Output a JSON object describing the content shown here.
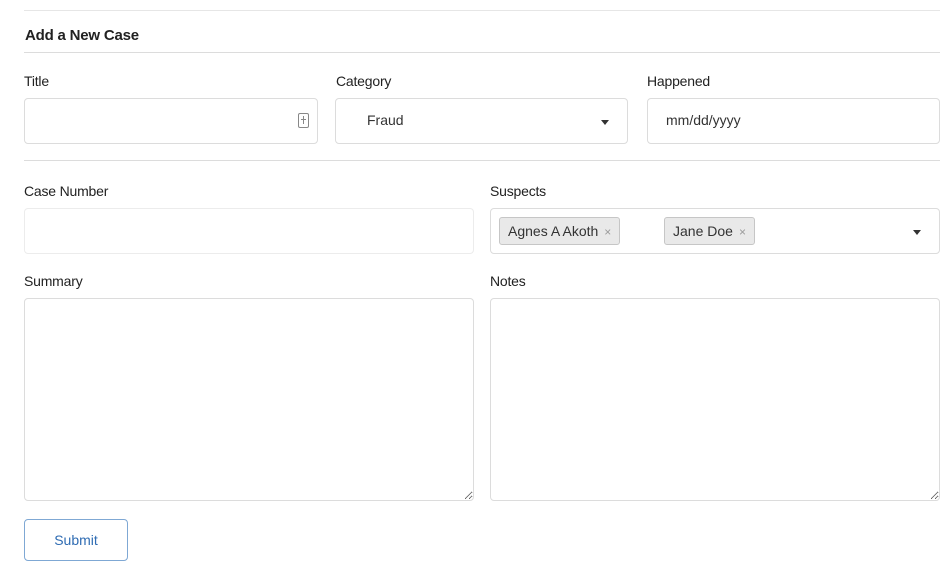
{
  "form": {
    "title": "Add a New Case",
    "fields": {
      "title": {
        "label": "Title",
        "value": ""
      },
      "category": {
        "label": "Category",
        "value": "Fraud"
      },
      "happened": {
        "label": "Happened",
        "placeholder": "mm/dd/yyyy"
      },
      "case_number": {
        "label": "Case Number",
        "value": ""
      },
      "suspects": {
        "label": "Suspects",
        "tags": [
          {
            "label": "Agnes A Akoth",
            "remove": "×"
          },
          {
            "label": "Jane Doe",
            "remove": "×"
          }
        ]
      },
      "summary": {
        "label": "Summary",
        "value": ""
      },
      "notes": {
        "label": "Notes",
        "value": ""
      }
    },
    "submit_label": "Submit"
  }
}
